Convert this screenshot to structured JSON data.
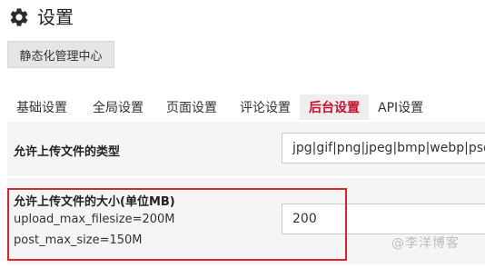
{
  "header": {
    "title": "设置",
    "icon": "gear-icon"
  },
  "static_button": {
    "label": "静态化管理中心"
  },
  "tabs": [
    {
      "label": "基础设置",
      "active": false
    },
    {
      "label": "全局设置",
      "active": false
    },
    {
      "label": "页面设置",
      "active": false
    },
    {
      "label": "评论设置",
      "active": false
    },
    {
      "label": "后台设置",
      "active": true
    },
    {
      "label": "API设置",
      "active": false
    }
  ],
  "settings": {
    "allowed_types": {
      "label": "允许上传文件的类型",
      "value": "jpg|gif|png|jpeg|bmp|webp|psd|wmv"
    },
    "max_size": {
      "label": "允许上传文件的大小(单位MB)",
      "hint1": "upload_max_filesize=200M",
      "hint2": "post_max_size=150M",
      "value": "200"
    }
  },
  "watermark": "@李洋博客",
  "colors": {
    "accent": "#c8102e",
    "highlight": "#e0222b"
  }
}
